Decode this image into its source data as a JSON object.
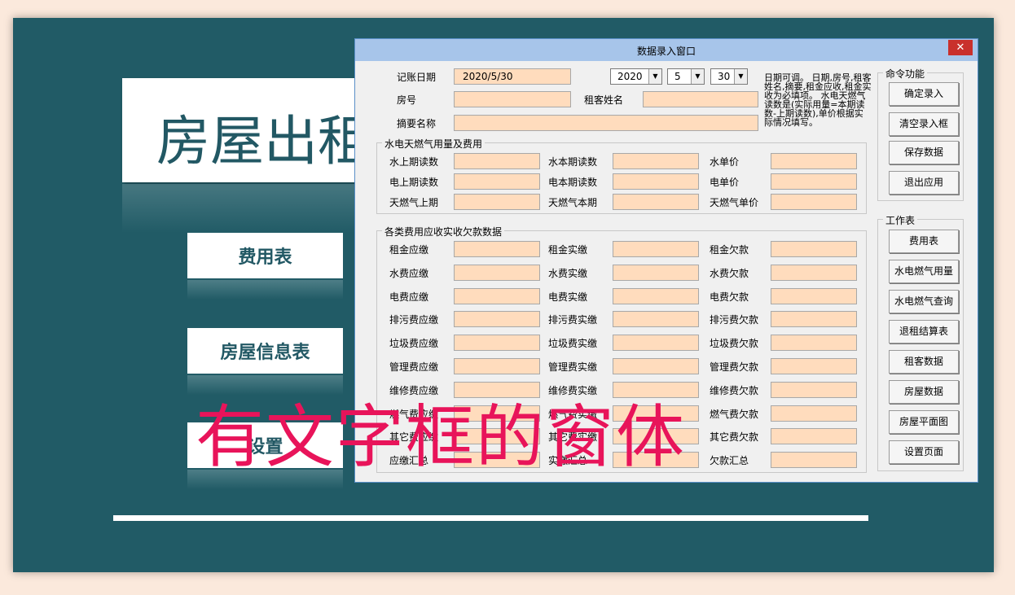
{
  "background": {
    "title_partial": "房屋出租",
    "nav": [
      "费用表",
      "房屋信息表",
      "设置"
    ]
  },
  "dialog": {
    "title": "数据录入窗口",
    "close_label": "✕",
    "top_fields": {
      "date_label": "记账日期",
      "date_value": "2020/5/30",
      "year": "2020",
      "month": "5",
      "day": "30",
      "room_label": "房号",
      "tenant_label": "租客姓名",
      "summary_label": "摘要名称"
    },
    "note": "日期可调。 日期,房号,租客姓名,摘要,租金应收,租金实收为必填项。 水电天燃气读数是(实际用量=本期读数-上期读数),单价根据实际情况填写。",
    "utility_frame": {
      "title": "水电天燃气用量及费用",
      "rows": [
        [
          "水上期读数",
          "水本期读数",
          "水单价"
        ],
        [
          "电上期读数",
          "电本期读数",
          "电单价"
        ],
        [
          "天燃气上期",
          "天燃气本期",
          "天燃气单价"
        ]
      ]
    },
    "fees_frame": {
      "title": "各类费用应收实收欠款数据",
      "rows": [
        [
          "租金应缴",
          "租金实缴",
          "租金欠款"
        ],
        [
          "水费应缴",
          "水费实缴",
          "水费欠款"
        ],
        [
          "电费应缴",
          "电费实缴",
          "电费欠款"
        ],
        [
          "排污费应缴",
          "排污费实缴",
          "排污费欠款"
        ],
        [
          "垃圾费应缴",
          "垃圾费实缴",
          "垃圾费欠款"
        ],
        [
          "管理费应缴",
          "管理费实缴",
          "管理费欠款"
        ],
        [
          "维修费应缴",
          "维修费实缴",
          "维修费欠款"
        ],
        [
          "燃气费应缴",
          "燃气费实缴",
          "燃气费欠款"
        ],
        [
          "其它费应缴",
          "其它费实缴",
          "其它费欠款"
        ],
        [
          "应缴汇总",
          "实缴汇总",
          "欠款汇总"
        ]
      ]
    },
    "commands": {
      "title": "命令功能",
      "buttons": [
        "确定录入",
        "清空录入框",
        "保存数据",
        "退出应用"
      ]
    },
    "sheets": {
      "title": "工作表",
      "buttons": [
        "费用表",
        "水电燃气用量",
        "水电燃气查询",
        "退租结算表",
        "租客数据",
        "房屋数据",
        "房屋平面图",
        "设置页面"
      ]
    }
  },
  "overlay_text": "有文字框的窗体"
}
